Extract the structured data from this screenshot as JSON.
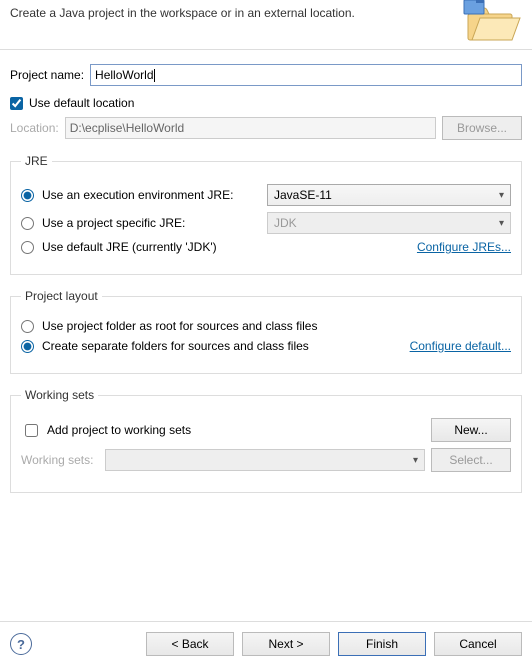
{
  "header": {
    "subtitle": "Create a Java project in the workspace or in an external location."
  },
  "project": {
    "name_label": "Project name:",
    "name_value": "HelloWorld",
    "use_default_label": "Use default location",
    "use_default_checked": true,
    "location_label": "Location:",
    "location_value": "D:\\ecplise\\HelloWorld",
    "browse_label": "Browse..."
  },
  "jre": {
    "legend": "JRE",
    "opt_exec_env": "Use an execution environment JRE:",
    "exec_env_value": "JavaSE-11",
    "opt_project_specific": "Use a project specific JRE:",
    "project_specific_value": "JDK",
    "opt_default": "Use default JRE (currently 'JDK')",
    "configure_link": "Configure JREs...",
    "selected": "exec_env"
  },
  "layout": {
    "legend": "Project layout",
    "opt_root": "Use project folder as root for sources and class files",
    "opt_separate": "Create separate folders for sources and class files",
    "configure_link": "Configure default...",
    "selected": "separate"
  },
  "ws": {
    "legend": "Working sets",
    "add_label": "Add project to working sets",
    "add_checked": false,
    "new_label": "New...",
    "sets_label": "Working sets:",
    "select_label": "Select..."
  },
  "footer": {
    "back": "< Back",
    "next": "Next >",
    "finish": "Finish",
    "cancel": "Cancel"
  }
}
